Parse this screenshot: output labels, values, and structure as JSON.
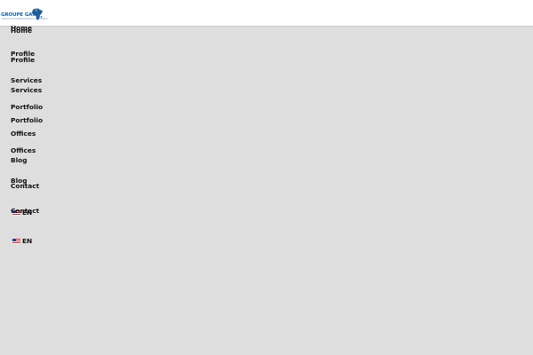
{
  "header": {
    "logo_text": "GROUPE GATO",
    "logo_subtitle": "GROUP OF INTERNATIONAL COMPANIES"
  },
  "menu_primary": [
    {
      "label": "Home"
    },
    {
      "label": "Profile"
    },
    {
      "label": "Services"
    },
    {
      "label": "Portfolio"
    },
    {
      "label": "Offices"
    },
    {
      "label": "Blog"
    },
    {
      "label": "Contact"
    }
  ],
  "menu_secondary": [
    {
      "label": "Home"
    },
    {
      "label": "Profile"
    },
    {
      "label": "Services"
    },
    {
      "label": "Portfolio"
    },
    {
      "label": "Offices"
    },
    {
      "label": "Blog"
    },
    {
      "label": "Contact"
    }
  ],
  "language": {
    "primary_label": "EN",
    "secondary_label": "EN",
    "flag_icon": "us-flag-icon"
  },
  "colors": {
    "background": "#dedede",
    "header_background": "#ffffff",
    "logo_blue": "#1c5f9c",
    "logo_accent": "#f0a020"
  }
}
